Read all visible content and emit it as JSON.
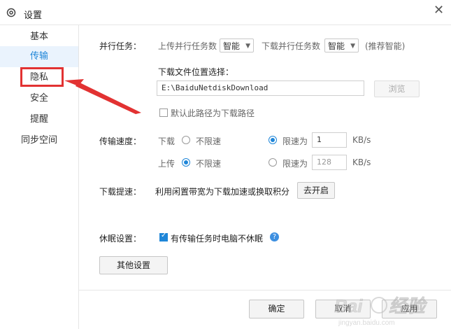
{
  "window": {
    "title": "设置",
    "close_glyph": "✕"
  },
  "sidebar": {
    "items": [
      {
        "label": "基本",
        "active": false
      },
      {
        "label": "传输",
        "active": true
      },
      {
        "label": "隐私",
        "active": false
      },
      {
        "label": "安全",
        "active": false
      },
      {
        "label": "提醒",
        "active": false
      },
      {
        "label": "同步空间",
        "active": false
      }
    ]
  },
  "parallel": {
    "label": "并行任务：",
    "upload_label": "上传并行任务数",
    "upload_value": "智能",
    "download_label": "下载并行任务数",
    "download_value": "智能",
    "hint": "(推荐智能)"
  },
  "location": {
    "label": "下载文件位置选择：",
    "path": "E:\\BaiduNetdiskDownload",
    "browse": "浏览",
    "default_checkbox": "默认此路径为下载路径"
  },
  "speed": {
    "label": "传输速度：",
    "download_label": "下载",
    "upload_label": "上传",
    "unlimited": "不限速",
    "limit_to": "限速为",
    "download_limit": "1",
    "upload_limit": "128",
    "unit": "KB/s"
  },
  "boost": {
    "label": "下载提速：",
    "text": "利用闲置带宽为下载加速或换取积分",
    "button": "去开启"
  },
  "sleep": {
    "label": "休眠设置：",
    "checkbox": "有传输任务时电脑不休眠",
    "help": "?"
  },
  "other_settings": "其他设置",
  "footer": {
    "ok": "确定",
    "cancel": "取消",
    "apply": "应用"
  },
  "annotation_colors": {
    "highlight": "#e23232",
    "accent": "#1f86d8"
  }
}
